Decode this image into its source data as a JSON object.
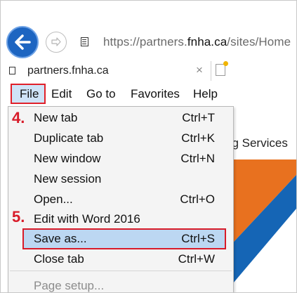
{
  "address_bar": {
    "url_prefix": "https://partners.",
    "url_domain": "fnha.ca",
    "url_suffix": "/sites/Home"
  },
  "tab": {
    "title": "partners.fnha.ca",
    "close_glyph": "×"
  },
  "menubar": {
    "file": "File",
    "edit": "Edit",
    "goto": "Go to",
    "favorites": "Favorites",
    "help": "Help"
  },
  "page": {
    "services_text": "ng Services"
  },
  "steps": {
    "step4": "4.",
    "step5": "5."
  },
  "file_menu": {
    "items": [
      {
        "label": "New tab",
        "shortcut": "Ctrl+T"
      },
      {
        "label": "Duplicate tab",
        "shortcut": "Ctrl+K"
      },
      {
        "label": "New window",
        "shortcut": "Ctrl+N"
      },
      {
        "label": "New session",
        "shortcut": ""
      },
      {
        "label": "Open...",
        "shortcut": "Ctrl+O"
      },
      {
        "label": "Edit with Word 2016",
        "shortcut": ""
      },
      {
        "label": "Save as...",
        "shortcut": "Ctrl+S"
      },
      {
        "label": "Close tab",
        "shortcut": "Ctrl+W"
      },
      {
        "label": "Page setup...",
        "shortcut": ""
      }
    ]
  },
  "colors": {
    "accent_blue": "#1d65c1",
    "highlight_red": "#d81b29",
    "selection_bg": "#bcd7f2",
    "art_orange": "#e8711f",
    "art_blue": "#1565b5"
  }
}
